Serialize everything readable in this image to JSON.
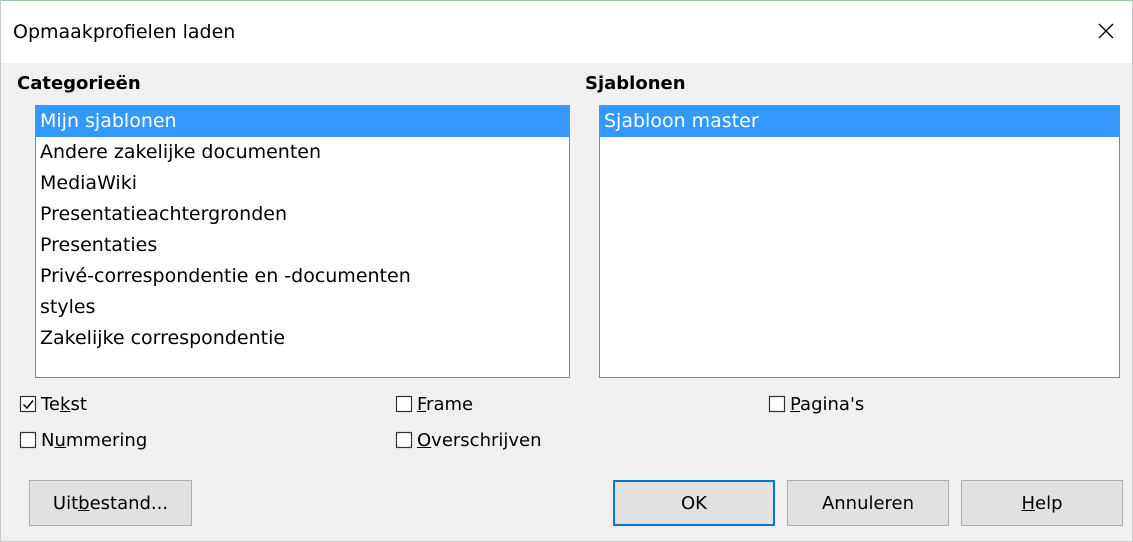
{
  "window": {
    "title": "Opmaakprofielen laden"
  },
  "categories": {
    "label": "Categorieën",
    "items": [
      "Mijn sjablonen",
      "Andere zakelijke documenten",
      "MediaWiki",
      "Presentatieachtergronden",
      "Presentaties",
      "Privé-correspondentie en -documenten",
      "styles",
      "Zakelijke correspondentie"
    ],
    "selected": "Mijn sjablonen"
  },
  "templates": {
    "label": "Sjablonen",
    "items": [
      "Sjabloon master"
    ],
    "selected": "Sjabloon master"
  },
  "options": {
    "tekst": {
      "pre": "Te",
      "key": "k",
      "post": "st",
      "checked": true
    },
    "frame": {
      "pre": "",
      "key": "F",
      "post": "rame",
      "checked": false
    },
    "paginas": {
      "pre": "",
      "key": "P",
      "post": "agina's",
      "checked": false
    },
    "nummering": {
      "pre": "N",
      "key": "u",
      "post": "mmering",
      "checked": false
    },
    "overschrijven": {
      "pre": "",
      "key": "O",
      "post": "verschrijven",
      "checked": false
    }
  },
  "buttons": {
    "from_file": {
      "pre": "Uit ",
      "key": "b",
      "post": "estand..."
    },
    "ok": "OK",
    "cancel": "Annuleren",
    "help": {
      "pre": "",
      "key": "H",
      "post": "elp"
    }
  },
  "colors": {
    "selection": "#3399ff",
    "default_button_border": "#0078d7"
  }
}
